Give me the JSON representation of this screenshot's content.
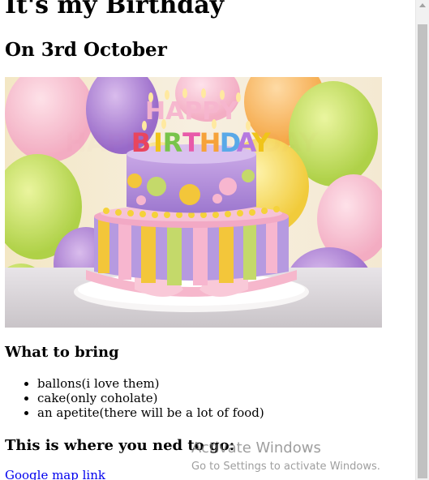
{
  "page": {
    "title": "It's my Birthday",
    "subtitle": "On 3rd October"
  },
  "hero_image": {
    "icon": "birthday-cake-photo",
    "candle_text": "HAPPY BIRTHDAY",
    "alt": "Birthday cake"
  },
  "bring": {
    "heading": "What to bring",
    "items": [
      "ballons(i love them)",
      "cake(only coholate)",
      "an apetite(there will be a lot of food)"
    ]
  },
  "directions": {
    "heading": "This is where you ned to go:",
    "link_label": "Google map link"
  },
  "overlay": {
    "line1": "Activate Windows",
    "line2": "Go to Settings to activate Windows."
  },
  "colors": {
    "link": "#0000ee",
    "text": "#000000",
    "scrollbar_thumb": "#c1c1c1"
  }
}
